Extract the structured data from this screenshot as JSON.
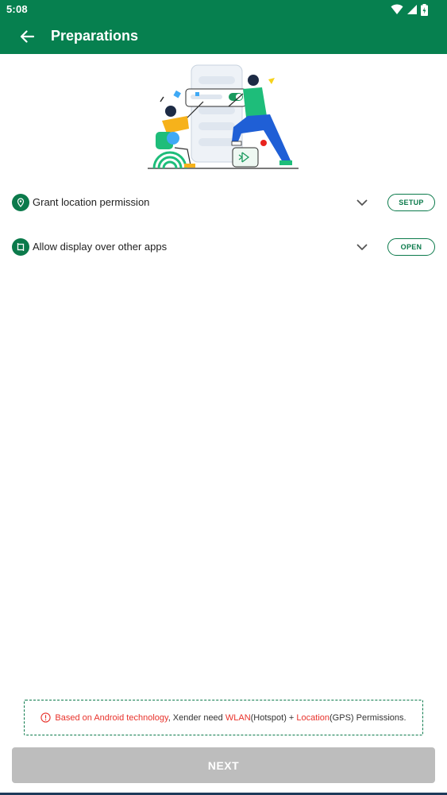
{
  "status_bar": {
    "time": "5:08"
  },
  "header": {
    "title": "Preparations"
  },
  "permissions": [
    {
      "label": "Grant location permission",
      "button": "SETUP",
      "icon": "location-pin-icon"
    },
    {
      "label": "Allow display over other apps",
      "button": "OPEN",
      "icon": "overlay-window-icon"
    }
  ],
  "notice": {
    "part1": "Based on Android technology",
    "part2": ", Xender need ",
    "part3": "WLAN",
    "part4": "(Hotspot) + ",
    "part5": "Location",
    "part6": "(GPS) Permissions."
  },
  "footer": {
    "next_label": "NEXT"
  },
  "colors": {
    "brand": "#06804f",
    "accent": "#0b7a4b",
    "warning": "#e8322b",
    "disabled": "#bdbdbd"
  }
}
